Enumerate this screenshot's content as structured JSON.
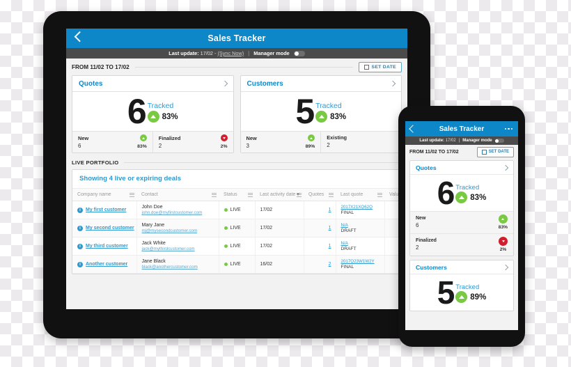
{
  "app": {
    "title": "Sales Tracker",
    "back_icon": "back-chevron-icon",
    "overflow_icon": "more-options-icon"
  },
  "status_bar": {
    "update_label": "Last update:",
    "update_value": "17/02",
    "dash": "-",
    "sync_link": "(Sync Now)",
    "separator": "|",
    "manager_mode_label": "Manager mode"
  },
  "date_range": {
    "label": "FROM 11/02 TO 17/02",
    "set_date_button": "SET DATE"
  },
  "cards": [
    {
      "title": "Quotes",
      "big_number": "6",
      "tracked_label": "Tracked",
      "trend_pct": "83%",
      "trend_dir": "up",
      "footers": [
        {
          "name": "New",
          "value": "6",
          "pct": "83%",
          "dir": "up"
        },
        {
          "name": "Finalized",
          "value": "2",
          "pct": "2%",
          "dir": "down"
        }
      ]
    },
    {
      "title": "Customers",
      "big_number": "5",
      "tracked_label": "Tracked",
      "trend_pct": "83%",
      "trend_dir": "up",
      "footers": [
        {
          "name": "New",
          "value": "3",
          "pct": "89%",
          "dir": "up"
        },
        {
          "name": "Existing",
          "value": "2",
          "pct": "",
          "dir": "none"
        }
      ]
    }
  ],
  "portfolio": {
    "section_title": "LIVE PORTFOLIO",
    "panel_heading": "Showing 4 live or expiring deals",
    "columns": [
      "Company name",
      "Contact",
      "Status",
      "Last activity date",
      "Quotes",
      "Last quote",
      "Value"
    ],
    "sorted_column": "Last activity date",
    "rows": [
      {
        "company": "My first customer",
        "contact_name": "John Doe",
        "contact_email": "john.doe@myfirstcustomer.com",
        "status": "LIVE",
        "last_activity": "17/02",
        "quotes": "1",
        "last_quote_ref": "2017X21XQ62Q",
        "last_quote_state": "FINAL"
      },
      {
        "company": "My second customer",
        "contact_name": "Mary Jane",
        "contact_email": "mj@mysecondcustomer.com",
        "status": "LIVE",
        "last_activity": "17/02",
        "quotes": "1",
        "last_quote_ref": "N/A",
        "last_quote_state": "DRAFT"
      },
      {
        "company": "My third customer",
        "contact_name": "Jack White",
        "contact_email": "jack@mythirdcustomer.com",
        "status": "LIVE",
        "last_activity": "17/02",
        "quotes": "1",
        "last_quote_ref": "N/A",
        "last_quote_state": "DRAFT"
      },
      {
        "company": "Another customer",
        "contact_name": "Jane Black",
        "contact_email": "black@anothercustomer.com",
        "status": "LIVE",
        "last_activity": "16/02",
        "quotes": "2",
        "last_quote_ref": "2017Q23W1W2Y",
        "last_quote_state": "FINAL"
      }
    ]
  },
  "phone": {
    "title": "Sales Tracker",
    "status": {
      "update_label": "Last update:",
      "update_value": "17/02",
      "separator": "|",
      "manager_mode_label": "Manager mode"
    },
    "date_label": "FROM 11/02 TO 17/02",
    "set_date_button": "SET DATE",
    "cards": [
      {
        "title": "Quotes",
        "big_number": "6",
        "tracked_label": "Tracked",
        "trend_pct": "83%",
        "rows": [
          {
            "name": "New",
            "value": "6",
            "pct": "83%",
            "dir": "up"
          },
          {
            "name": "Finalized",
            "value": "2",
            "pct": "2%",
            "dir": "down"
          }
        ]
      },
      {
        "title": "Customers",
        "big_number": "5",
        "tracked_label": "Tracked",
        "trend_pct": "89%",
        "rows": []
      }
    ]
  },
  "colors": {
    "brand_blue": "#0d87c8",
    "link_blue": "#2e9ad0",
    "green": "#7ac943",
    "red": "#cf1f2e",
    "status_gray": "#4b4b4b"
  }
}
